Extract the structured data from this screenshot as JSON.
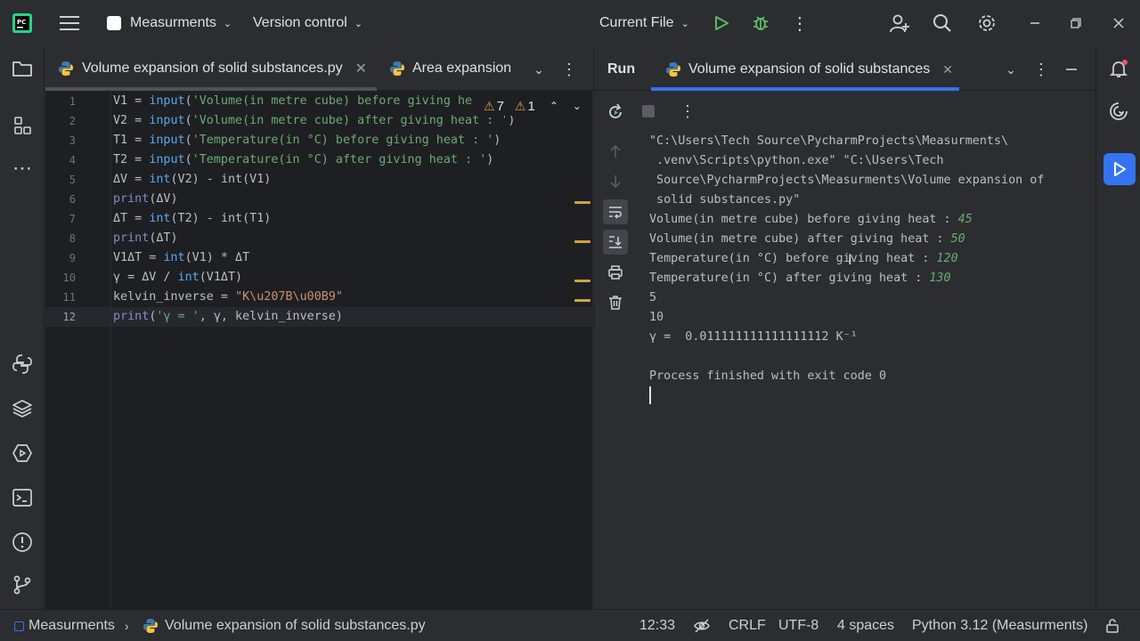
{
  "titlebar": {
    "project_name": "Measurments",
    "vcs_label": "Version control",
    "run_config": "Current File"
  },
  "editor": {
    "tabs": [
      {
        "label": "Volume expansion of solid substances.py",
        "active": true
      },
      {
        "label": "Area expansion",
        "active": false
      }
    ],
    "inspections": {
      "warnings": "7",
      "weak_warnings": "1"
    },
    "line_numbers": [
      "1",
      "2",
      "3",
      "4",
      "5",
      "6",
      "7",
      "8",
      "9",
      "10",
      "11",
      "12"
    ],
    "lines": [
      {
        "a": "V1 = ",
        "fn": "input",
        "b": "(",
        "s": "'Volume(in metre cube) before giving he",
        "c": ""
      },
      {
        "a": "V2 = ",
        "fn": "input",
        "b": "(",
        "s": "'Volume(in metre cube) after giving heat : '",
        "c": ")"
      },
      {
        "a": "T1 = ",
        "fn": "input",
        "b": "(",
        "s": "'Temperature(in °C) before giving heat : '",
        "c": ")"
      },
      {
        "a": "T2 = ",
        "fn": "input",
        "b": "(",
        "s": "'Temperature(in °C) after giving heat : '",
        "c": ")"
      },
      {
        "a": "ΔV = ",
        "fn": "int",
        "b": "(V2) - ",
        "s": "",
        "c": "int(V1)"
      },
      {
        "a": "",
        "fn": "print",
        "b": "(ΔV)",
        "s": "",
        "c": ""
      },
      {
        "a": "ΔT = ",
        "fn": "int",
        "b": "(T2) - ",
        "s": "",
        "c": "int(T1)"
      },
      {
        "a": "",
        "fn": "print",
        "b": "(ΔT)",
        "s": "",
        "c": ""
      },
      {
        "a": "V1ΔT = ",
        "fn": "int",
        "b": "(V1) * ΔT",
        "s": "",
        "c": ""
      },
      {
        "a": "γ = ΔV / ",
        "fn": "int",
        "b": "(V1ΔT)",
        "s": "",
        "c": ""
      },
      {
        "a": "kelvin_inverse = ",
        "fn": "",
        "b": "",
        "s": "\"K\\u207B\\u00B9\"",
        "c": ""
      },
      {
        "a": "",
        "fn": "print",
        "b": "(",
        "s": "'γ = '",
        "c": ", γ, kelvin_inverse)"
      }
    ]
  },
  "run": {
    "tool_label": "Run",
    "tab_label": "Volume expansion of solid substances",
    "console": [
      {
        "text": "\"C:\\Users\\Tech Source\\PycharmProjects\\Measurments\\",
        "input": ""
      },
      {
        "text": " .venv\\Scripts\\python.exe\" \"C:\\Users\\Tech",
        "input": ""
      },
      {
        "text": " Source\\PycharmProjects\\Measurments\\Volume expansion of",
        "input": ""
      },
      {
        "text": " solid substances.py\"",
        "input": ""
      },
      {
        "text": "Volume(in metre cube) before giving heat : ",
        "input": "45"
      },
      {
        "text": "Volume(in metre cube) after giving heat : ",
        "input": "50"
      },
      {
        "text": "Temperature(in °C) before giving heat : ",
        "input": "120"
      },
      {
        "text": "Temperature(in °C) after giving heat : ",
        "input": "130"
      },
      {
        "text": "5",
        "input": ""
      },
      {
        "text": "10",
        "input": ""
      },
      {
        "text": "γ =  0.011111111111111112 K⁻¹",
        "input": ""
      },
      {
        "text": "",
        "input": ""
      },
      {
        "text": "Process finished with exit code 0",
        "input": ""
      }
    ]
  },
  "statusbar": {
    "breadcrumb_project": "Measurments",
    "breadcrumb_file": "Volume expansion of solid substances.py",
    "position": "12:33",
    "line_sep": "CRLF",
    "encoding": "UTF-8",
    "indent": "4 spaces",
    "interpreter": "Python 3.12 (Measurments)"
  },
  "colors": {
    "accent": "#3574f0",
    "run_green": "#5fb865",
    "warning": "#d4a43b"
  }
}
